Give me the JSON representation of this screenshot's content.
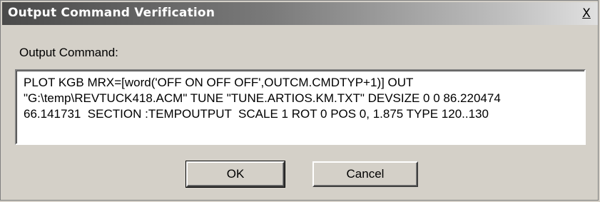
{
  "window": {
    "title": "Output Command Verification",
    "close_label": "X"
  },
  "form": {
    "label": "Output Command:",
    "command_text": "PLOT KGB MRX=[word('OFF ON OFF OFF',OUTCM.CMDTYP+1)] OUT\n\"G:\\temp\\REVTUCK418.ACM\" TUNE \"TUNE.ARTIOS.KM.TXT\" DEVSIZE 0 0 86.220474\n66.141731  SECTION :TEMPOUTPUT  SCALE 1 ROT 0 POS 0, 1.875 TYPE 120..130"
  },
  "buttons": {
    "ok_label": "OK",
    "cancel_label": "Cancel"
  },
  "icons": {
    "close": "close-icon"
  }
}
